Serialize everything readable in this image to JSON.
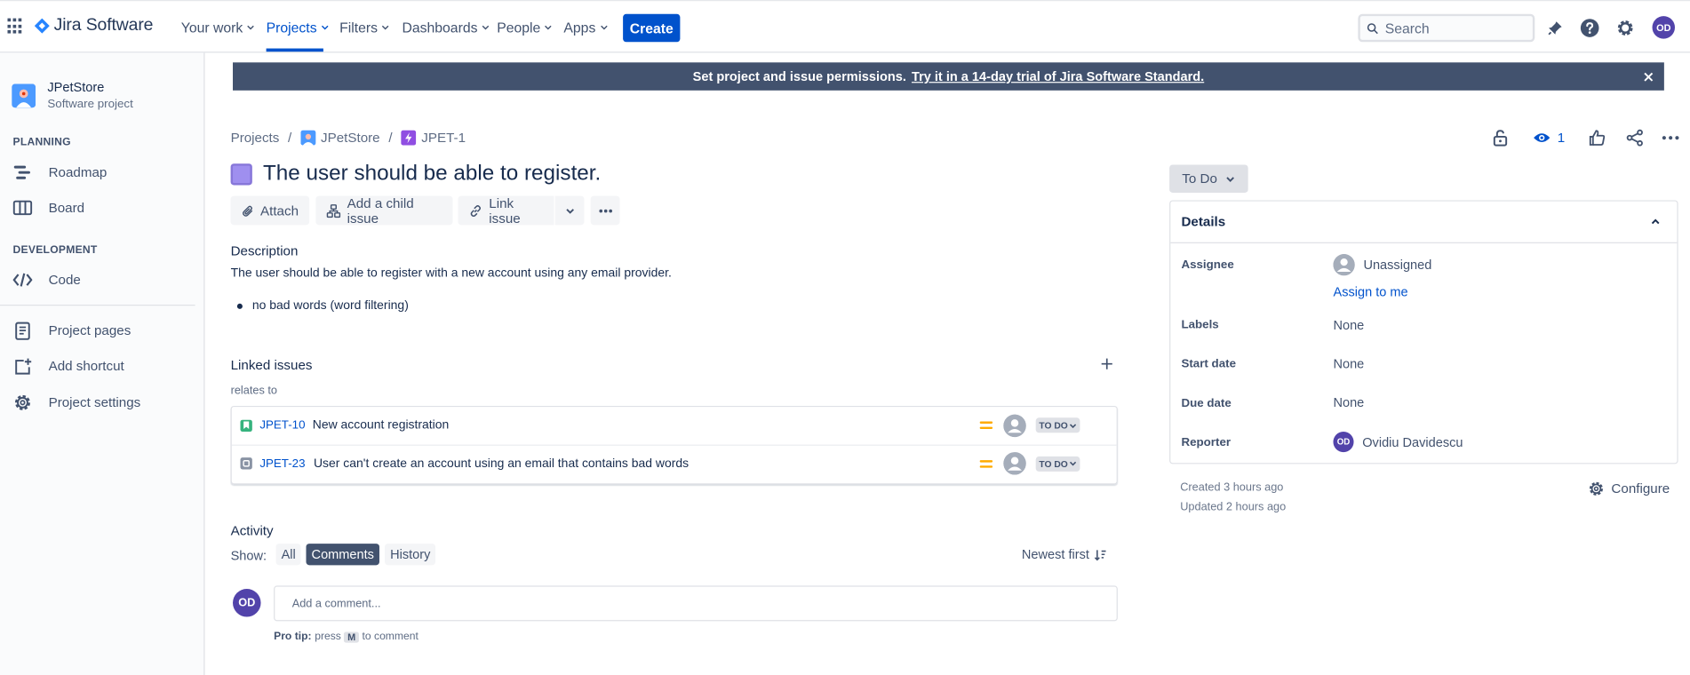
{
  "topnav": {
    "brand": "Jira Software",
    "items": [
      {
        "label": "Your work"
      },
      {
        "label": "Projects"
      },
      {
        "label": "Filters"
      },
      {
        "label": "Dashboards"
      },
      {
        "label": "People"
      },
      {
        "label": "Apps"
      }
    ],
    "create_label": "Create",
    "search_placeholder": "Search",
    "avatar_initials": "OD"
  },
  "sidebar": {
    "project_name": "JPetStore",
    "project_type": "Software project",
    "planning_header": "PLANNING",
    "planning_items": [
      {
        "label": "Roadmap"
      },
      {
        "label": "Board"
      }
    ],
    "development_header": "DEVELOPMENT",
    "development_items": [
      {
        "label": "Code"
      }
    ],
    "footer_items": [
      {
        "label": "Project pages"
      },
      {
        "label": "Add shortcut"
      },
      {
        "label": "Project settings"
      }
    ]
  },
  "banner": {
    "text": "Set project and issue permissions.",
    "link": "Try it in a 14-day trial of Jira Software Standard."
  },
  "breadcrumb": [
    "Projects",
    "JPetStore",
    "JPET-1"
  ],
  "issue": {
    "watchers_count": "1",
    "title": "The user should be able to register.",
    "toolbar": {
      "attach": "Attach",
      "add_child": "Add a child issue",
      "link_issue": "Link issue"
    },
    "description_label": "Description",
    "description_text": "The user should be able to register with a new account using any email provider.",
    "description_bullets": [
      "no bad words (word filtering)"
    ],
    "linked_issues_label": "Linked issues",
    "relation_label": "relates to",
    "linked_issues": [
      {
        "key": "JPET-10",
        "summary": "New account registration",
        "status": "TO DO",
        "type": "story"
      },
      {
        "key": "JPET-23",
        "summary": "User can't create an account using an email that contains bad words",
        "status": "TO DO",
        "type": "task"
      }
    ]
  },
  "activity": {
    "label": "Activity",
    "show_label": "Show:",
    "tabs": [
      {
        "label": "All"
      },
      {
        "label": "Comments"
      },
      {
        "label": "History"
      }
    ],
    "active_tab": "Comments",
    "sort_label": "Newest first",
    "comment_placeholder": "Add a comment...",
    "avatar_initials": "OD",
    "pro_tip_label": "Pro tip:",
    "pro_tip_press": "press",
    "pro_tip_key": "M",
    "pro_tip_suffix": "to comment"
  },
  "details": {
    "status": "To Do",
    "header": "Details",
    "fields": {
      "assignee_label": "Assignee",
      "assignee_value": "Unassigned",
      "assign_to_me": "Assign to me",
      "labels_label": "Labels",
      "labels_value": "None",
      "start_date_label": "Start date",
      "start_date_value": "None",
      "due_date_label": "Due date",
      "due_date_value": "None",
      "reporter_label": "Reporter",
      "reporter_value": "Ovidiu Davidescu",
      "reporter_initials": "OD"
    },
    "created": "Created 3 hours ago",
    "updated": "Updated 2 hours ago",
    "configure_label": "Configure"
  },
  "colors": {
    "brand_blue": "#0052CC",
    "banner_bg": "#42526E",
    "avatar_purple": "#5243AA",
    "priority_medium": "#FFAB00",
    "story_green": "#36B37E",
    "epic_purple": "#9F8FEF"
  }
}
